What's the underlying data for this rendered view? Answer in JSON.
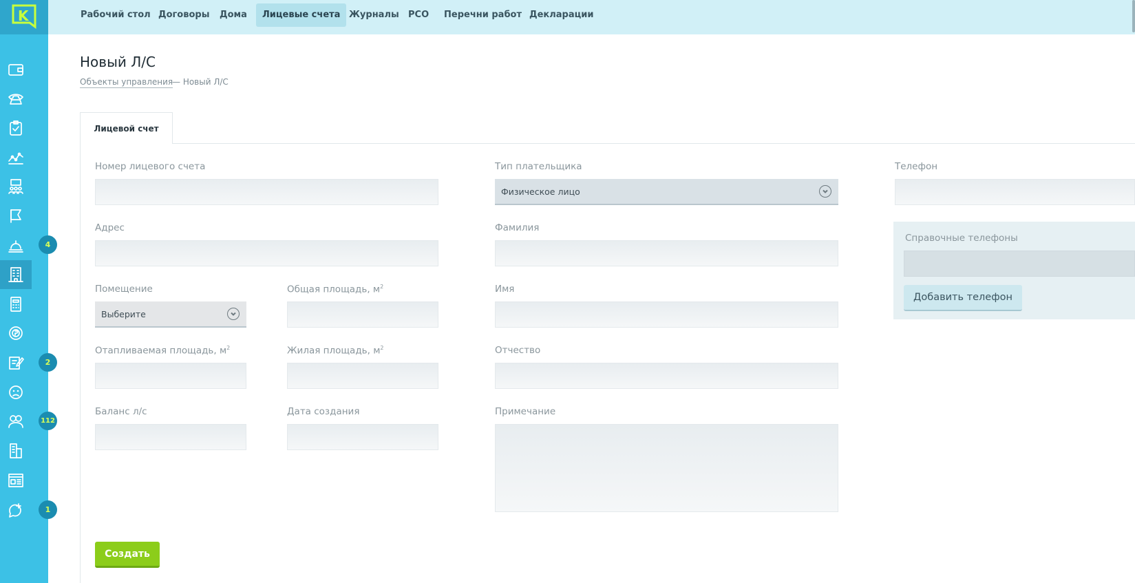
{
  "brand": {
    "logo_letter": "K",
    "accent": "#3cc1e6",
    "logo_color": "#c8ff3c"
  },
  "nav": {
    "items": [
      {
        "label": "Рабочий стол"
      },
      {
        "label": "Договоры"
      },
      {
        "label": "Дома"
      },
      {
        "label": "Лицевые счета",
        "active": true
      },
      {
        "label": "Журналы"
      },
      {
        "label": "РСО"
      },
      {
        "label": "Перечни работ"
      },
      {
        "label": "Декларации"
      }
    ]
  },
  "sidebar": {
    "items": [
      {
        "icon": "wallet-icon"
      },
      {
        "icon": "phone-icon"
      },
      {
        "icon": "clipboard-check-icon"
      },
      {
        "icon": "chart-line-icon"
      },
      {
        "icon": "people-board-icon"
      },
      {
        "icon": "flag-icon"
      },
      {
        "icon": "concierge-bell-icon",
        "badge": "4"
      },
      {
        "icon": "building-icon",
        "active": true
      },
      {
        "icon": "calculator-icon"
      },
      {
        "icon": "coin-icon"
      },
      {
        "icon": "edit-document-icon",
        "badge": "2"
      },
      {
        "icon": "sad-face-icon"
      },
      {
        "icon": "users-group-icon",
        "badge": "112"
      },
      {
        "icon": "buildings-icon"
      },
      {
        "icon": "browser-window-icon"
      },
      {
        "icon": "chat-add-icon",
        "badge": "1"
      }
    ]
  },
  "page": {
    "title": "Новый Л/С",
    "breadcrumb_link": "Объекты управления",
    "breadcrumb_rest": "— Новый Л/С"
  },
  "tabs": [
    {
      "label": "Лицевой счет"
    }
  ],
  "form": {
    "account_number_label": "Номер лицевого счета",
    "address_label": "Адрес",
    "premises_label": "Помещение",
    "premises_value": "Выберите",
    "total_area_label": "Общая площадь, м",
    "heated_area_label": "Отапливаемая площадь, м",
    "living_area_label": "Жилая площадь, м",
    "area_unit_sup": "2",
    "balance_label": "Баланс л/с",
    "created_date_label": "Дата создания",
    "payer_type_label": "Тип плательщика",
    "payer_type_value": "Физическое лицо",
    "last_name_label": "Фамилия",
    "first_name_label": "Имя",
    "patronymic_label": "Отчество",
    "note_label": "Примечание",
    "phone_label": "Телефон",
    "ref_phones_label": "Справочные телефоны",
    "add_phone_label": "Добавить телефон",
    "create_label": "Создать"
  }
}
